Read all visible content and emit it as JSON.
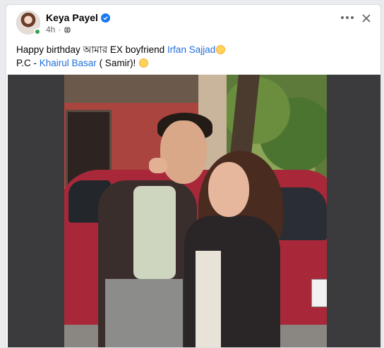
{
  "post": {
    "author": "Keya Payel",
    "time": "4h",
    "caption_text": "Happy birthday আমার EX boyfriend ",
    "caption_tag1": "Irfan Sajjad",
    "caption_line2_prefix": "P.C - ",
    "caption_tag2": "Khairul Basar",
    "caption_line2_suffix": " ( Samir)!"
  },
  "icons": {
    "verified": "verified-badge-icon",
    "privacy": "globe-icon",
    "more": "more-options-icon",
    "close": "close-icon",
    "emoji1": "sad-face-emoji",
    "emoji2": "laughing-face-emoji"
  },
  "colors": {
    "link": "#216fdb",
    "verified": "#1877f2",
    "online": "#31a24c",
    "photo_backdrop": "#3b3a3d"
  }
}
